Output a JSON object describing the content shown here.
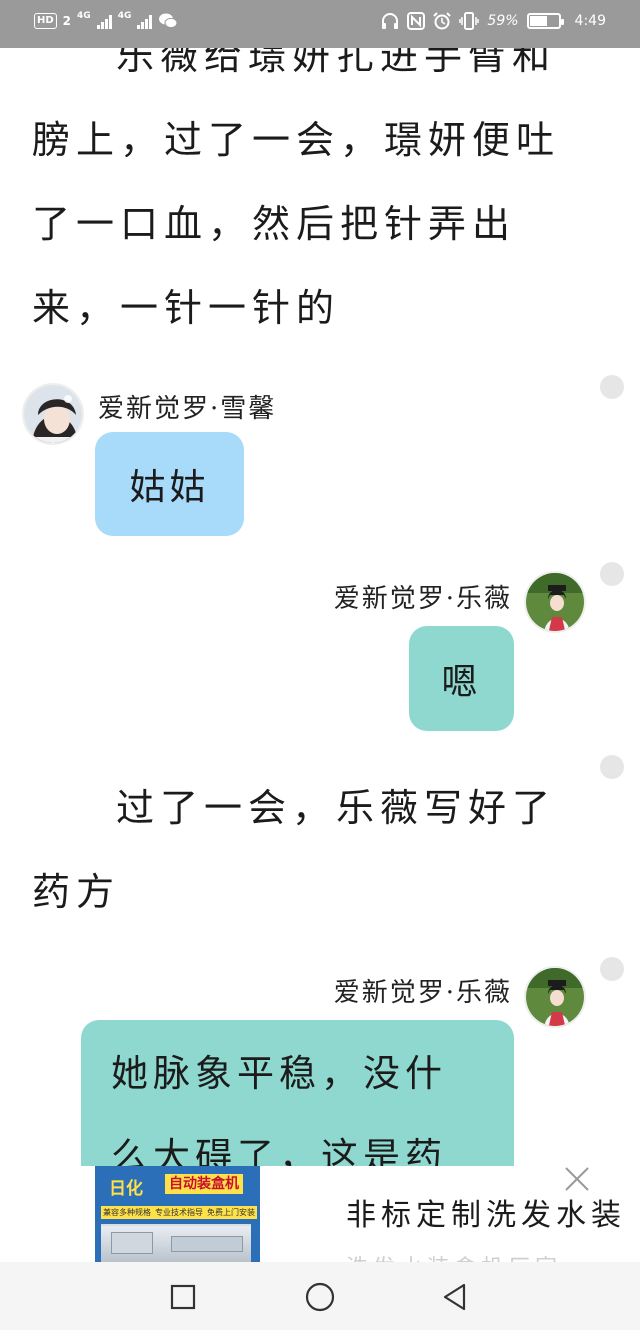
{
  "status_bar": {
    "hd_label": "HD",
    "sim_number": "2",
    "net1": "4G",
    "net2": "4G",
    "battery_percent_text": "59%",
    "battery_level": 0.59,
    "time": "4:49"
  },
  "paragraphs": [
    {
      "lines": [
        "乐薇给璟妍扎进手臂和",
        "膀上，过了一会，璟妍便吐",
        "了一口血，然后把针弄出",
        "来，一针一针的"
      ]
    },
    {
      "lines": [
        "过了一会，乐薇写好了",
        "药方"
      ]
    }
  ],
  "messages": [
    {
      "sender": "爱新觉罗·雪馨",
      "text": "姑姑"
    },
    {
      "sender": "爱新觉罗·乐薇",
      "text": "嗯"
    },
    {
      "sender": "爱新觉罗·乐薇",
      "lines": [
        "她脉象平稳，没什",
        "么大碍了，这是药"
      ]
    }
  ],
  "ad": {
    "brand": "日化",
    "brand_tagline": "自动装盒机",
    "tags": [
      "兼容多种规格",
      "专业技术指导",
      "免费上门安装"
    ],
    "title": "非标定制洗发水装",
    "faded_line": "洗发水装盒机厂家"
  },
  "colors": {
    "status_bar_bg": "#9a9a9a",
    "bubble_blue": "#a8dbf9",
    "bubble_teal": "#8fd8d0",
    "navbar_bg": "#f5f5f5"
  },
  "icons": [
    "headphones-icon",
    "nfc-icon",
    "alarm-icon",
    "vibrate-icon",
    "battery-icon",
    "wechat-icon",
    "close-icon",
    "back-icon",
    "home-icon",
    "recents-icon"
  ]
}
